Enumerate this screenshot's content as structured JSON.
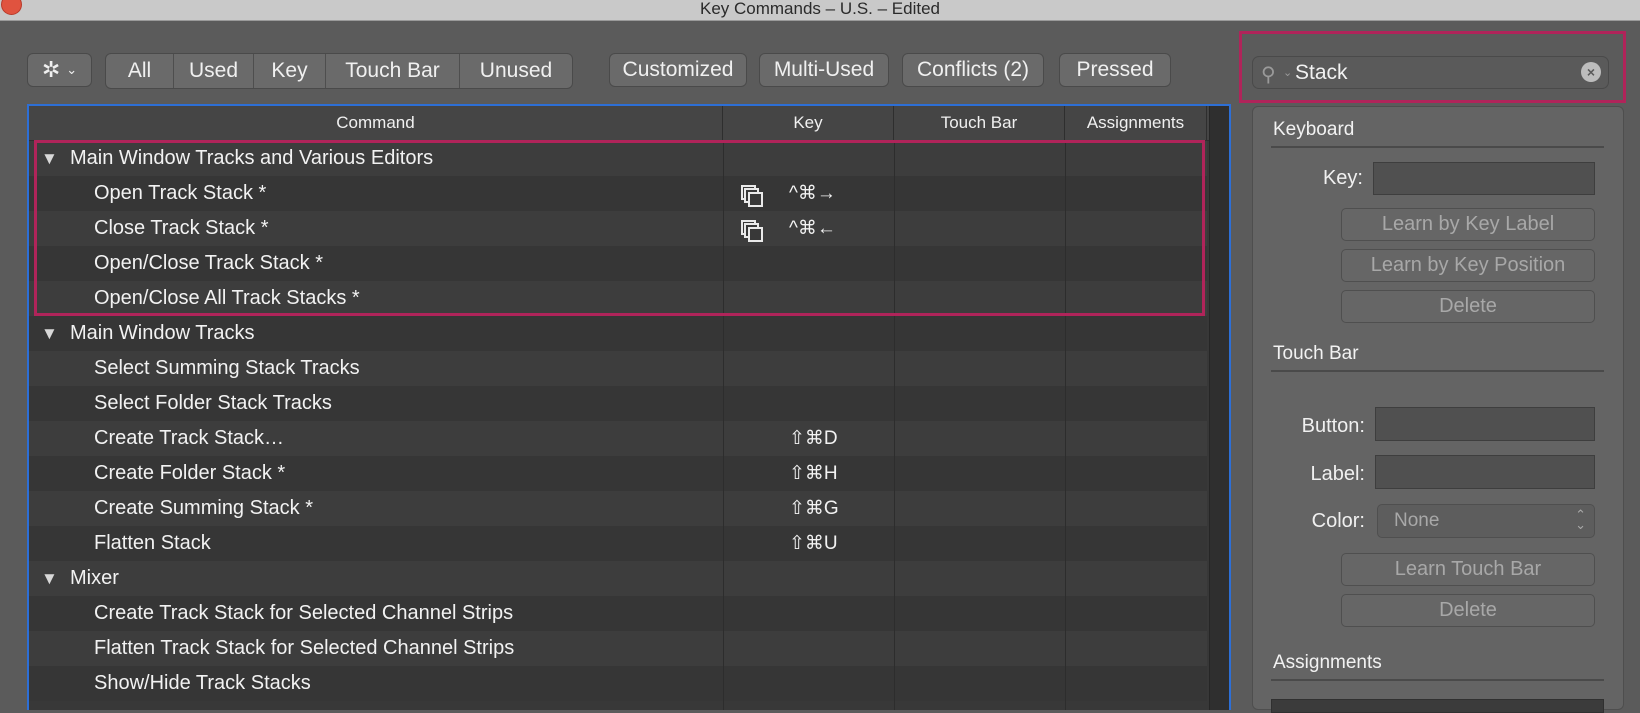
{
  "window": {
    "title": "Key Commands – U.S. – Edited"
  },
  "toolbar": {
    "gear_icon": "gear-icon",
    "filters": [
      "All",
      "Used",
      "Key",
      "Touch Bar",
      "Unused"
    ],
    "customized": "Customized",
    "multi_used": "Multi-Used",
    "conflicts": "Conflicts (2)",
    "pressed": "Pressed"
  },
  "search": {
    "value": "Stack"
  },
  "table": {
    "columns": [
      "Command",
      "Key",
      "Touch Bar",
      "Assignments"
    ],
    "rows": [
      {
        "type": "group",
        "label": "Main Window Tracks and Various Editors",
        "key": ""
      },
      {
        "type": "item",
        "label": "Open Track Stack *",
        "key": "^⌘→",
        "icon": true
      },
      {
        "type": "item",
        "label": "Close Track Stack *",
        "key": "^⌘←",
        "icon": true
      },
      {
        "type": "item",
        "label": "Open/Close Track Stack *",
        "key": ""
      },
      {
        "type": "item",
        "label": "Open/Close All Track Stacks *",
        "key": ""
      },
      {
        "type": "group",
        "label": "Main Window Tracks",
        "key": ""
      },
      {
        "type": "item",
        "label": "Select Summing Stack Tracks",
        "key": ""
      },
      {
        "type": "item",
        "label": "Select Folder Stack Tracks",
        "key": ""
      },
      {
        "type": "item",
        "label": "Create Track Stack…",
        "key": "⇧⌘D"
      },
      {
        "type": "item",
        "label": "Create Folder Stack *",
        "key": "⇧⌘H"
      },
      {
        "type": "item",
        "label": "Create Summing Stack *",
        "key": "⇧⌘G"
      },
      {
        "type": "item",
        "label": "Flatten Stack",
        "key": "⇧⌘U"
      },
      {
        "type": "group",
        "label": "Mixer",
        "key": ""
      },
      {
        "type": "item",
        "label": "Create Track Stack for Selected Channel Strips",
        "key": ""
      },
      {
        "type": "item",
        "label": "Flatten Track Stack for Selected Channel Strips",
        "key": ""
      },
      {
        "type": "item",
        "label": "Show/Hide Track Stacks",
        "key": ""
      }
    ]
  },
  "panel": {
    "keyboard": {
      "title": "Keyboard",
      "key_label": "Key:",
      "learn_label": "Learn by Key Label",
      "learn_position": "Learn by Key Position",
      "delete": "Delete"
    },
    "touch_bar": {
      "title": "Touch Bar",
      "button_label": "Button:",
      "label_label": "Label:",
      "color_label": "Color:",
      "color_value": "None",
      "learn": "Learn Touch Bar",
      "delete": "Delete"
    },
    "assignments": {
      "title": "Assignments"
    }
  }
}
